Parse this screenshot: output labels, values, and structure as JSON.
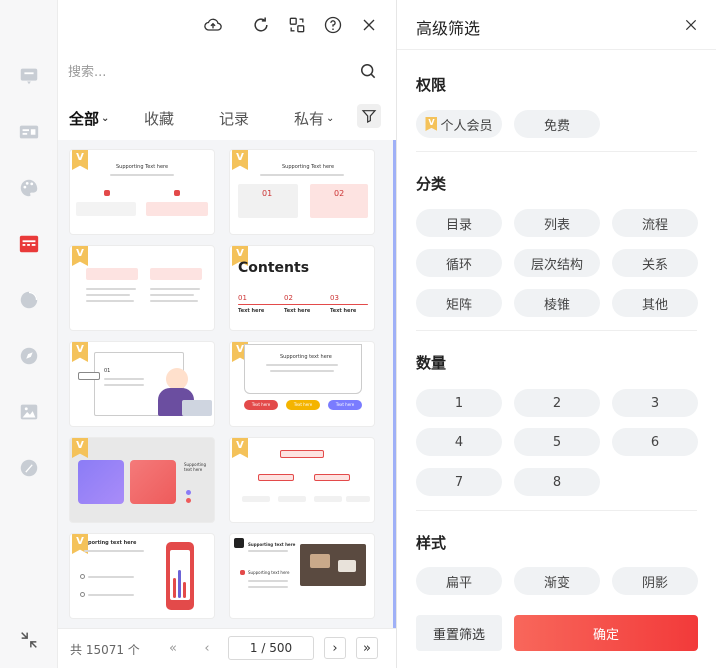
{
  "topbar": {
    "icons": [
      "cloud-upload-icon",
      "refresh-icon",
      "switch-icon",
      "help-icon",
      "close-icon"
    ]
  },
  "search": {
    "placeholder": "搜索..."
  },
  "tabs": [
    {
      "label": "全部",
      "active": true,
      "dropdown": true
    },
    {
      "label": "收藏",
      "active": false,
      "dropdown": false
    },
    {
      "label": "记录",
      "active": false,
      "dropdown": false
    },
    {
      "label": "私有",
      "active": false,
      "dropdown": true
    }
  ],
  "thumbnails": {
    "badge": "V",
    "t1_title": "Supporting Text here",
    "t2_title": "Supporting Text here",
    "t2_n1": "01",
    "t2_n2": "02",
    "t4_title": "Contents",
    "t4_n1": "01",
    "t4_n2": "02",
    "t4_n3": "03",
    "t4_l1": "Text here",
    "t4_l2": "Text here",
    "t4_l3": "Text here",
    "t5_n": "01",
    "t6_title": "Supporting text here",
    "t6_b1": "Text here",
    "t6_b2": "Text here",
    "t6_b3": "Text here",
    "t7_label": "Supporting text here",
    "t9_title": "porting text here",
    "t10_title": "Supporting text here",
    "t10_sub": "Supporting text here"
  },
  "pager": {
    "total": "共 15071 个",
    "page": "1 / 500",
    "first": "«",
    "prev": "‹",
    "next": "›",
    "last": "»"
  },
  "filter": {
    "title": "高级筛选",
    "sections": {
      "permission": {
        "title": "权限",
        "options": [
          "个人会员",
          "免费"
        ]
      },
      "category": {
        "title": "分类",
        "options": [
          "目录",
          "列表",
          "流程",
          "循环",
          "层次结构",
          "关系",
          "矩阵",
          "棱锥",
          "其他"
        ]
      },
      "count": {
        "title": "数量",
        "options": [
          "1",
          "2",
          "3",
          "4",
          "5",
          "6",
          "7",
          "8"
        ]
      },
      "style": {
        "title": "样式",
        "options": [
          "扁平",
          "渐变",
          "阴影"
        ]
      }
    },
    "reset_label": "重置筛选",
    "confirm_label": "确定",
    "colors": {
      "accent": "#f23a3a",
      "vip": "#f4c25a",
      "chip_bg": "#f0f2f4"
    }
  },
  "rail": {
    "icons": [
      "slideshow-icon",
      "card-icon",
      "palette-icon",
      "template-icon",
      "pie-chart-icon",
      "compass-icon",
      "image-icon",
      "brush-icon",
      "collapse-icon"
    ],
    "active_index": 3
  }
}
